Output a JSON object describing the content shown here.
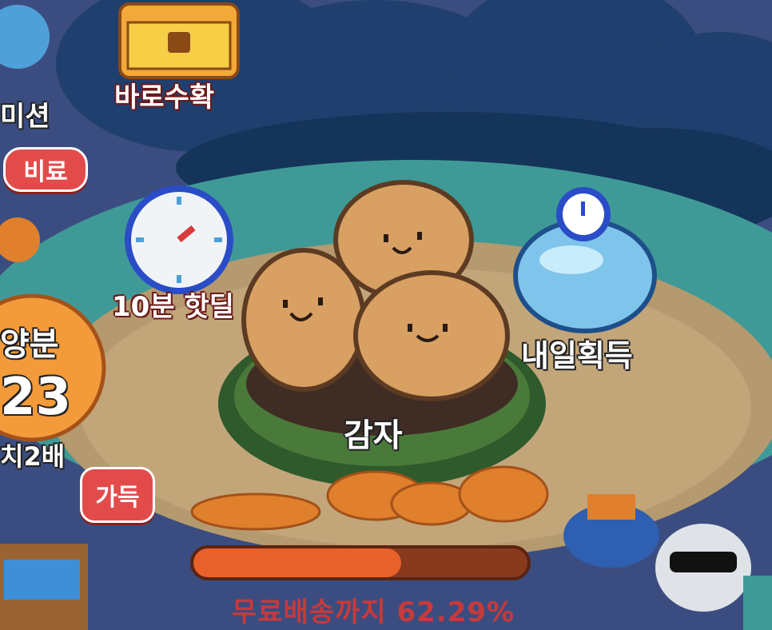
{
  "menu": {
    "harvest_now_label": "바로수확",
    "mission_label": "미션",
    "fertilizer_label": "비료",
    "ten_min_hotdeal_label": "10분 핫딜",
    "double_label": "치2배",
    "full_label": "가득",
    "amount_label": "양분",
    "amount_value": "23",
    "item_label": "내일획득"
  },
  "crop": {
    "name": "감자"
  },
  "progress": {
    "label": "무료배송까지 62.29%",
    "percent": 62.29
  },
  "colors": {
    "accent_red": "#e34b4b",
    "progress_fill": "#e8612b",
    "progress_track": "#8a3a1c"
  }
}
